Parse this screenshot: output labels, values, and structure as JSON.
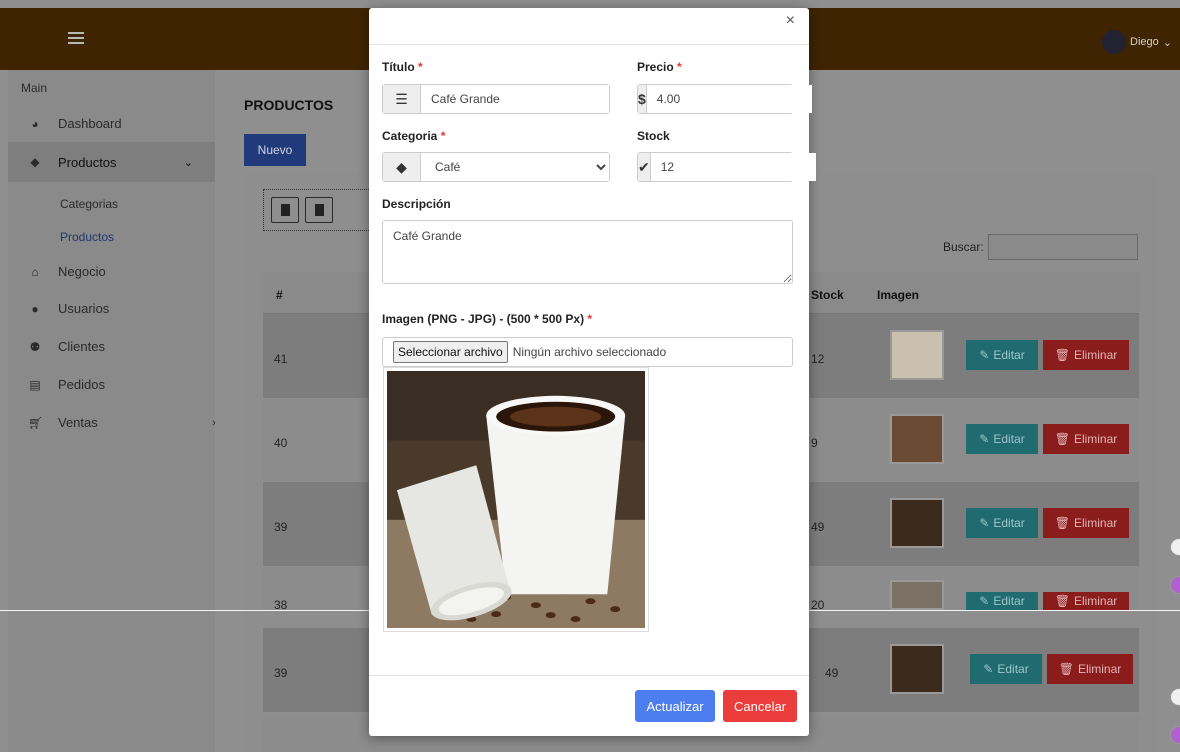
{
  "topbar": {
    "user_name": "Diego"
  },
  "sidebar": {
    "section_label": "Main",
    "items": [
      {
        "label": "Dashboard",
        "icon": "palette-icon"
      },
      {
        "label": "Productos",
        "icon": "tags-icon"
      },
      {
        "label": "Negocio",
        "icon": "home-icon"
      },
      {
        "label": "Usuarios",
        "icon": "user-icon"
      },
      {
        "label": "Clientes",
        "icon": "users-icon"
      },
      {
        "label": "Pedidos",
        "icon": "list-icon"
      },
      {
        "label": "Ventas",
        "icon": "cart-icon"
      }
    ],
    "sub_items": [
      "Categorias",
      "Productos"
    ]
  },
  "content": {
    "title": "PRODUCTOS",
    "new_button": "Nuevo",
    "search_label": "Buscar:",
    "columns": {
      "id": "#",
      "stock": "Stock",
      "image": "Imagen"
    },
    "rows": [
      {
        "id": "41",
        "stock": "12"
      },
      {
        "id": "40",
        "stock": "9"
      },
      {
        "id": "39",
        "stock": "49"
      },
      {
        "id": "38",
        "stock": "20"
      },
      {
        "id": "39",
        "stock": "49"
      }
    ],
    "edit_label": "Editar",
    "delete_label": "Eliminar"
  },
  "modal": {
    "title_label": "Título",
    "title_value": "Café Grande",
    "price_label": "Precio",
    "price_value": "4.00",
    "category_label": "Categoria",
    "category_value": "Café",
    "stock_label": "Stock",
    "stock_value": "12",
    "description_label": "Descripción",
    "description_value": "Café Grande",
    "image_label": "Imagen (PNG - JPG) - (500 * 500 Px)",
    "file_button": "Seleccionar archivo",
    "file_status": "Ningún archivo seleccionado",
    "update_button": "Actualizar",
    "cancel_button": "Cancelar",
    "required_mark": "*",
    "close_symbol": "×"
  },
  "colors": {
    "topbar": "#3e2400",
    "primary": "#4c7ef0",
    "danger": "#ec3d3d",
    "required": "#e53935"
  }
}
